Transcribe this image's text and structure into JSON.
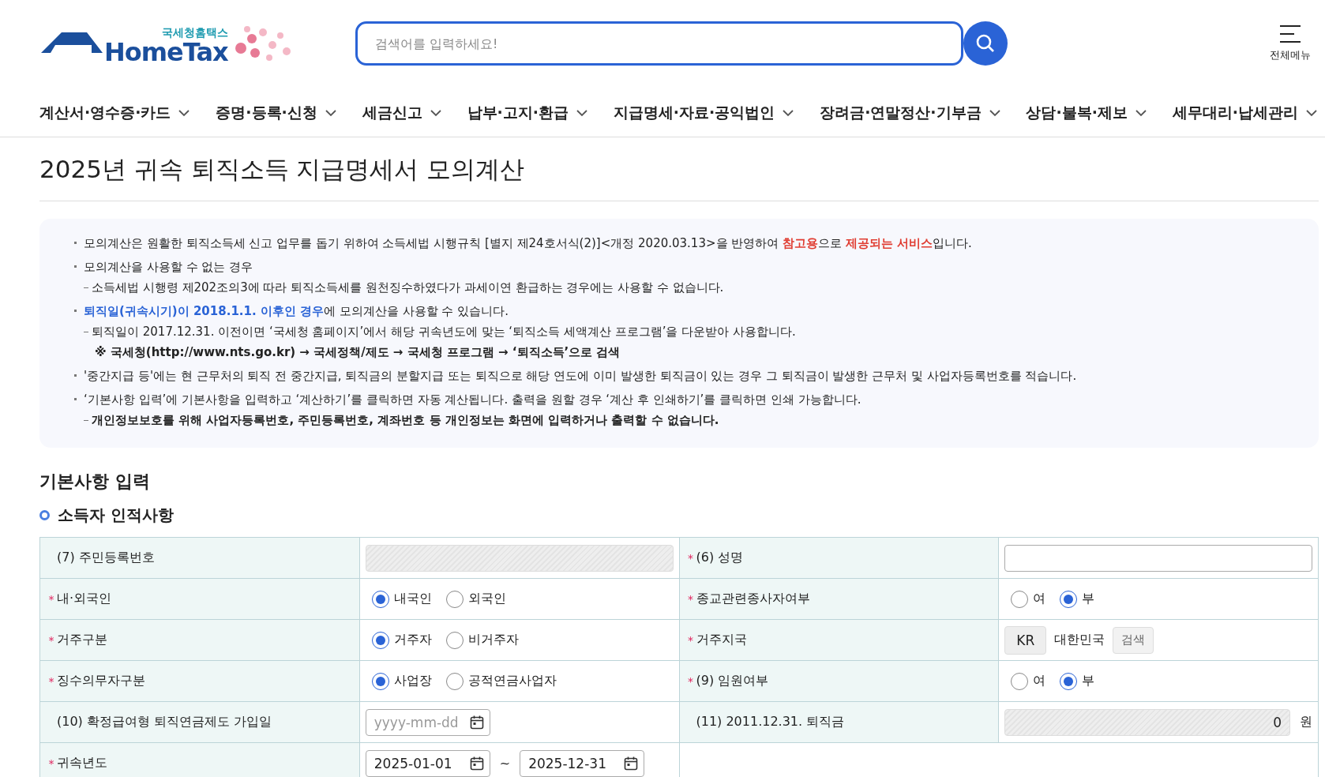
{
  "header": {
    "logo_caption": "국세청홈택스",
    "logo_text": "HomeTax",
    "search": {
      "placeholder": "검색어를 입력하세요!"
    },
    "menu_label": "전체메뉴"
  },
  "nav": [
    "계산서·영수증·카드",
    "증명·등록·신청",
    "세금신고",
    "납부·고지·환급",
    "지급명세·자료·공익법인",
    "장려금·연말정산·기부금",
    "상담·불복·제보",
    "세무대리·납세관리"
  ],
  "page_title": "2025년 귀속 퇴직소득 지급명세서 모의계산",
  "notice": [
    {
      "kind": "bullet",
      "color": "#e03c31",
      "bold": false,
      "text": "모의계산은 원활한 퇴직소득세 신고 업무를 돕기 위하여 소득세법 시행규칙 [별지 제24호서식(2)]<개정 2020.03.13>을 반영하여 **참고용**으로 **제공되는 서비스**입니다."
    },
    {
      "kind": "bullet",
      "bold": false,
      "text": "모의계산을 사용할 수 없는 경우"
    },
    {
      "kind": "sub",
      "bold": false,
      "text": "소득세법 시행령 제202조의3에 따라 퇴직소득세를 원천징수하였다가 과세이연 환급하는 경우에는 사용할 수 없습니다."
    },
    {
      "kind": "bullet",
      "color": "#2a63d6",
      "bold": false,
      "text": "**퇴직일(귀속시기)이 2018.1.1. 이후인 경우**에 모의계산을 사용할 수 있습니다."
    },
    {
      "kind": "sub",
      "bold": false,
      "text": "퇴직일이 2017.12.31. 이전이면 ‘국세청 홈페이지’에서 해당 귀속년도에 맞는 ‘퇴직소득 세액계산 프로그램’을 다운받아 사용합니다."
    },
    {
      "kind": "note",
      "bold": true,
      "text": "※ 국세청(http://www.nts.go.kr) → 국세정책/제도 → 국세청 프로그램 → ‘퇴직소득’으로 검색"
    },
    {
      "kind": "bullet",
      "bold": false,
      "text": "'중간지급 등'에는 현 근무처의 퇴직 전 중간지급, 퇴직금의 분할지급 또는 퇴직으로 해당 연도에 이미 발생한 퇴직금이 있는 경우 그 퇴직금이 발생한 근무처 및 사업자등록번호를 적습니다."
    },
    {
      "kind": "bullet",
      "bold": false,
      "text": "‘기본사항 입력’에 기본사항을 입력하고 ‘계산하기’를 클릭하면 자동 계산됩니다. 출력을 원할 경우 ‘계산 후 인쇄하기’를 클릭하면 인쇄 가능합니다."
    },
    {
      "kind": "sub",
      "bold": true,
      "text": "개인정보보호를 위해 사업자등록번호, 주민등록번호, 계좌번호 등 개인정보는 화면에 입력하거나 출력할 수 없습니다."
    }
  ],
  "section_title": "기본사항 입력",
  "subsection_title": "소득자 인적사항",
  "form_rows": [
    [
      {
        "label": "(7) 주민등록번호",
        "field": {
          "kind": "masked"
        }
      },
      {
        "marker": "*",
        "label": "(6) 성명",
        "field": {
          "kind": "text"
        }
      }
    ],
    [
      {
        "marker": "*",
        "label": "내·외국인",
        "field": {
          "kind": "radio",
          "options": [
            {
              "label": "내국인",
              "selected": true
            },
            {
              "label": "외국인",
              "selected": false
            }
          ]
        }
      },
      {
        "marker": "*",
        "label": "종교관련종사자여부",
        "field": {
          "kind": "radio",
          "options": [
            {
              "label": "여",
              "selected": false
            },
            {
              "label": "부",
              "selected": true
            }
          ]
        }
      }
    ],
    [
      {
        "marker": "*",
        "label": "거주구분",
        "field": {
          "kind": "radio",
          "options": [
            {
              "label": "거주자",
              "selected": true
            },
            {
              "label": "비거주자",
              "selected": false
            }
          ]
        }
      },
      {
        "marker": "*",
        "label": "거주지국",
        "field": {
          "kind": "country",
          "code": "KR",
          "name": "대한민국",
          "button": "검색"
        }
      }
    ],
    [
      {
        "marker": "*",
        "label": "징수의무자구분",
        "field": {
          "kind": "radio",
          "options": [
            {
              "label": "사업장",
              "selected": true
            },
            {
              "label": "공적연금사업자",
              "selected": false
            }
          ]
        }
      },
      {
        "marker": "*",
        "label": "(9) 임원여부",
        "field": {
          "kind": "radio",
          "options": [
            {
              "label": "여",
              "selected": false
            },
            {
              "label": "부",
              "selected": true
            }
          ]
        }
      }
    ],
    [
      {
        "label": "(10) 확정급여형 퇴직연금제도 가입일",
        "field": {
          "kind": "date",
          "placeholder": "yyyy-mm-dd"
        }
      },
      {
        "label": "(11) 2011.12.31. 퇴직금",
        "field": {
          "kind": "amount",
          "value": "0",
          "unit": "원"
        }
      }
    ],
    [
      {
        "marker": "*",
        "label": "귀속년도",
        "field": {
          "kind": "date_range",
          "from": "2025-01-01",
          "separator": "~",
          "to": "2025-12-31"
        }
      }
    ]
  ]
}
